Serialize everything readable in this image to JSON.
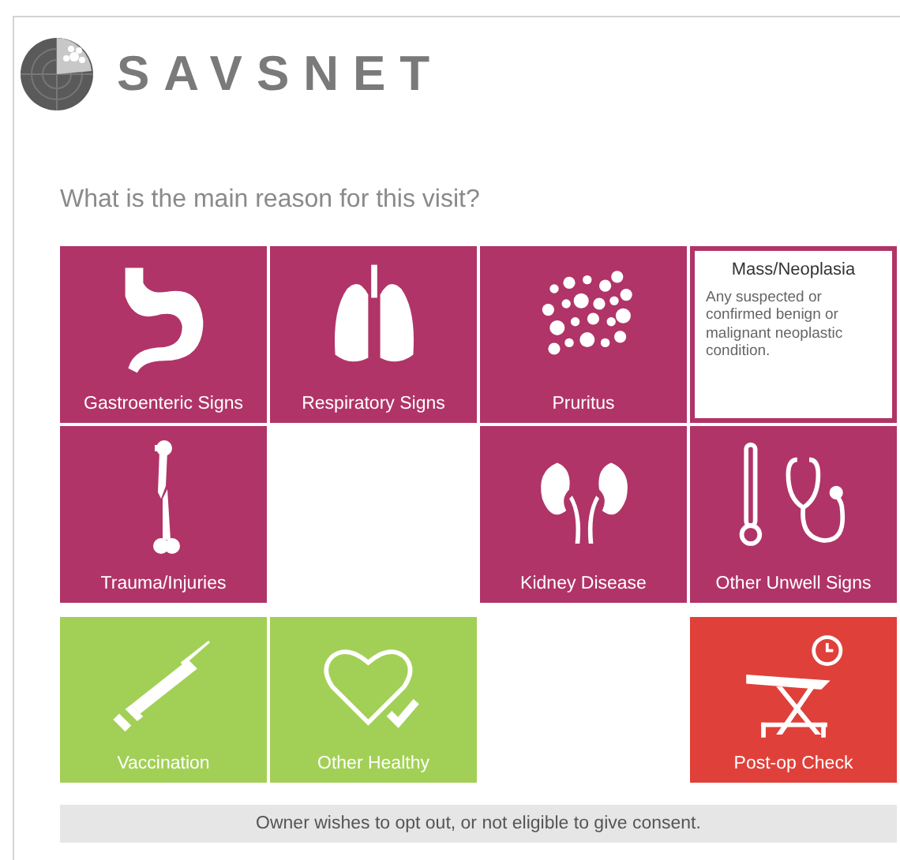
{
  "logo": {
    "text": "SAVSNET"
  },
  "question": "What is the main reason for this visit?",
  "tiles": [
    {
      "kind": "tile",
      "label": "Gastroenteric Signs",
      "color": "#b03468"
    },
    {
      "kind": "tile",
      "label": "Respiratory Signs",
      "color": "#b03468"
    },
    {
      "kind": "tile",
      "label": "Pruritus",
      "color": "#b03468"
    },
    {
      "kind": "info",
      "label": "Mass/Neoplasia",
      "description": "Any suspected or confirmed benign or malignant neoplastic condition.",
      "color": "#b03468"
    },
    {
      "kind": "tile",
      "label": "Trauma/Injuries",
      "color": "#b03468"
    },
    {
      "kind": "blank"
    },
    {
      "kind": "tile",
      "label": "Kidney Disease",
      "color": "#b03468"
    },
    {
      "kind": "tile",
      "label": "Other Unwell Signs",
      "color": "#b03468"
    },
    {
      "kind": "tile",
      "label": "Vaccination",
      "color": "#a2d056"
    },
    {
      "kind": "tile",
      "label": "Other Healthy",
      "color": "#a2d056"
    },
    {
      "kind": "blank"
    },
    {
      "kind": "tile",
      "label": "Post-op Check",
      "color": "#e0403a"
    }
  ],
  "opt_out": "Owner wishes to opt out, or not eligible to give consent."
}
